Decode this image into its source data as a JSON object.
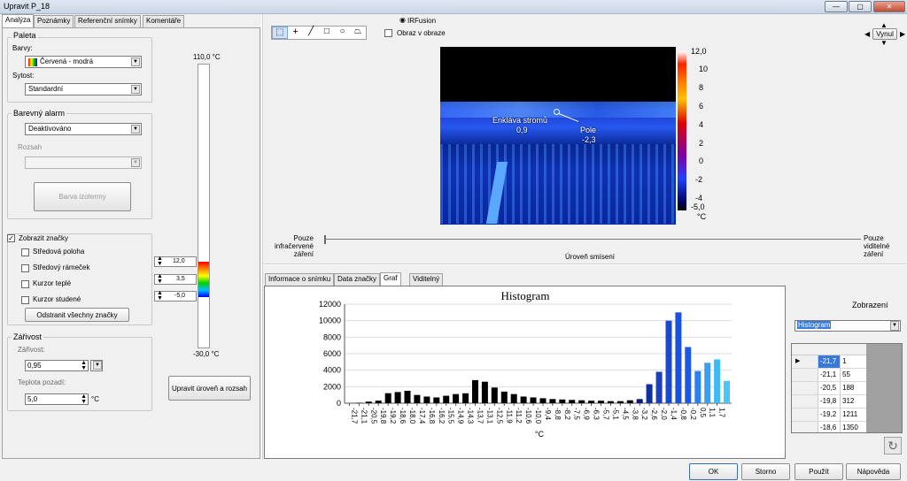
{
  "window": {
    "title": "Upravit P_18"
  },
  "tabs": [
    "Analýza",
    "Poznámky",
    "Referenční snímky",
    "Komentáře"
  ],
  "palette": {
    "group_label": "Paleta",
    "colors_label": "Barvy:",
    "colors_value": "Červená - modrá",
    "saturation_label": "Sytost:",
    "saturation_value": "Standardní"
  },
  "alarm": {
    "group_label": "Barevný alarm",
    "value": "Deaktivováno",
    "range_label": "Rozsah",
    "isotherm_button": "Barva izotermy"
  },
  "markers": {
    "show_label": "Zobrazit značky",
    "items": [
      "Středová poloha",
      "Středový rámeček",
      "Kurzor teplé",
      "Kurzor studené"
    ],
    "remove_button": "Odstranit všechny značky"
  },
  "emissivity": {
    "group_label": "Zářivost",
    "emissivity_label": "Zářivost:",
    "emissivity_value": "0,95",
    "bg_label": "Teplota pozadí:",
    "bg_value": "5,0",
    "bg_unit": "°C"
  },
  "scale": {
    "top": "110,0 °C",
    "bottom": "-30,0 °C",
    "marker_values": [
      "12,0",
      "3,5",
      "-5,0"
    ],
    "adjust_button": "Upravit úroveň a rozsah"
  },
  "image": {
    "irfusion_label": "IRFusion",
    "pip_label": "Obraz v obraze",
    "spot1_label": "Enkláva stromů",
    "spot1_value": "0,9",
    "spot2_label": "Pole",
    "spot2_value": "-2,3",
    "scale_ticks": [
      "12,0",
      "10",
      "8",
      "6",
      "4",
      "2",
      "0",
      "-2",
      "-4",
      "-5,0"
    ],
    "scale_unit": "°C",
    "zoom_button": "Vynul"
  },
  "blend": {
    "left_label": "Pouze infračervené záření",
    "right_label": "Pouze viditelné záření",
    "center_label": "Úroveň smísení"
  },
  "subtabs": [
    "Informace o snímku",
    "Data značky",
    "Graf",
    "Viditelný"
  ],
  "chart_data": {
    "type": "bar",
    "title": "Histogram",
    "xlabel": "°C",
    "ylabel": "",
    "ylim": [
      0,
      12000
    ],
    "yticks": [
      "0",
      "2000",
      "4000",
      "6000",
      "8000",
      "10000",
      "12000"
    ],
    "categories": [
      "-21,7",
      "-21,1",
      "-20,5",
      "-19,8",
      "-19,2",
      "-18,6",
      "-18,0",
      "-17,4",
      "-16,8",
      "-16,2",
      "-15,5",
      "-14,9",
      "-14,3",
      "-13,7",
      "-13,1",
      "-12,5",
      "-11,9",
      "-11,2",
      "-10,6",
      "-10,0",
      "-9,4",
      "-8,8",
      "-8,2",
      "-7,5",
      "-6,9",
      "-6,3",
      "-5,7",
      "-5,1",
      "-4,5",
      "-3,8",
      "-3,2",
      "-2,6",
      "-2,0",
      "-1,4",
      "-0,8",
      "-0,2",
      "0,5",
      "1,1",
      "1,7"
    ],
    "values": [
      1,
      55,
      188,
      312,
      1211,
      1350,
      1500,
      1000,
      800,
      700,
      900,
      1100,
      1200,
      2800,
      2600,
      1900,
      1400,
      1100,
      800,
      700,
      600,
      500,
      450,
      400,
      350,
      300,
      300,
      250,
      250,
      350,
      500,
      2300,
      3800,
      10000,
      11000,
      6800,
      3900,
      4900,
      5300,
      2700
    ],
    "colors": [
      "#000000",
      "#000000",
      "#000000",
      "#000000",
      "#000000",
      "#000000",
      "#000000",
      "#000000",
      "#000000",
      "#000000",
      "#000000",
      "#000000",
      "#000000",
      "#000000",
      "#000000",
      "#000000",
      "#000000",
      "#000000",
      "#000000",
      "#000000",
      "#000000",
      "#000000",
      "#000000",
      "#000000",
      "#000000",
      "#000000",
      "#000000",
      "#000000",
      "#000000",
      "#000000",
      "#0a1a7a",
      "#1030a0",
      "#1a40c0",
      "#1a48d0",
      "#1a50e0",
      "#1a58e8",
      "#2a80f0",
      "#38a0f0",
      "#40b8f0",
      "#48c8f0"
    ]
  },
  "view": {
    "label": "Zobrazení",
    "value": "Histogram",
    "table": [
      [
        "-21,7",
        "1"
      ],
      [
        "-21,1",
        "55"
      ],
      [
        "-20,5",
        "188"
      ],
      [
        "-19,8",
        "312"
      ],
      [
        "-19,2",
        "1211"
      ],
      [
        "-18,6",
        "1350"
      ]
    ]
  },
  "footer": {
    "ok": "OK",
    "cancel": "Storno",
    "apply": "Použít",
    "help": "Nápověda"
  }
}
